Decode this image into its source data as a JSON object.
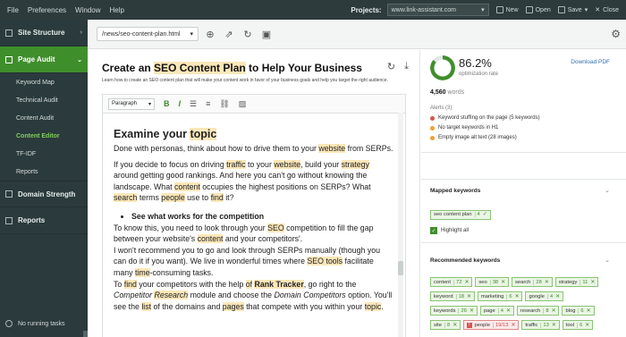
{
  "menu": [
    "File",
    "Preferences",
    "Window",
    "Help"
  ],
  "projects": {
    "label": "Projects:",
    "value": "www.link-assistant.com"
  },
  "toolbar_buttons": {
    "new": "New",
    "open": "Open",
    "save": "Save",
    "close": "Close"
  },
  "sidebar": {
    "site_structure": "Site Structure",
    "page_audit": "Page Audit",
    "sub_items": [
      "Keyword Map",
      "Technical Audit",
      "Content Audit",
      "Content Editor",
      "TF-IDF",
      "Reports"
    ],
    "active_sub": "Content Editor",
    "domain_strength": "Domain Strength",
    "reports": "Reports",
    "footer": "No running tasks"
  },
  "address": {
    "url": "/news/seo-content-plan.html"
  },
  "doc": {
    "title_pre": "Create an ",
    "title_hl": "SEO Content Plan",
    "title_post": " to Help Your Business",
    "desc": "Learn how to create an SEO content plan that will make your content work in favor of your business goals and help you target the right audience.",
    "paragraph_select": "Paragraph"
  },
  "content": {
    "heading_pre": "Examine your ",
    "heading_hl": "topic",
    "p1": [
      {
        "t": "Done with personas, think about how to drive them to your "
      },
      {
        "t": "website",
        "h": true
      },
      {
        "t": " from SERPs."
      }
    ],
    "p2": [
      {
        "t": "If you decide to focus on driving "
      },
      {
        "t": "traffic",
        "h": true
      },
      {
        "t": " to your "
      },
      {
        "t": "website",
        "h": true
      },
      {
        "t": ", build your "
      },
      {
        "t": "strategy",
        "h": true
      },
      {
        "t": " around getting good rankings. And here you can't go without knowing the landscape. What "
      },
      {
        "t": "content",
        "h": true
      },
      {
        "t": " occupies the highest positions on SERPs? What "
      },
      {
        "t": "search",
        "h": true
      },
      {
        "t": " terms "
      },
      {
        "t": "people",
        "h": true
      },
      {
        "t": " use to "
      },
      {
        "t": "find",
        "h": true
      },
      {
        "t": " it?"
      }
    ],
    "bullet": "See what works for the competition",
    "p3": [
      {
        "t": "To know this, you need to look through your "
      },
      {
        "t": "SEO",
        "h": true
      },
      {
        "t": " competition to fill the gap between your website's "
      },
      {
        "t": "content",
        "h": true
      },
      {
        "t": " and your competitors'."
      }
    ],
    "p4": [
      {
        "t": "I won't recommend you to go and look through SERPs manually (though you can do it if you want). We live in wonderful times where "
      },
      {
        "t": "SEO tools",
        "h": true
      },
      {
        "t": " facilitate many "
      },
      {
        "t": "time",
        "h": true
      },
      {
        "t": "-consuming tasks."
      }
    ],
    "p5": [
      {
        "t": "To "
      },
      {
        "t": "find",
        "h": true
      },
      {
        "t": " your competitors with the help "
      },
      {
        "t": "of",
        "h": true
      },
      {
        "t": " "
      },
      {
        "t": "Rank Tracker",
        "h": true,
        "b": true
      },
      {
        "t": ", go right to the "
      },
      {
        "t": "Competitor ",
        "i": true
      },
      {
        "t": "Research",
        "h": true,
        "i": true
      },
      {
        "t": " module and choose the "
      },
      {
        "t": "Domain Competitors",
        "i": true
      },
      {
        "t": " option. You'll see the "
      },
      {
        "t": "list",
        "h": true
      },
      {
        "t": " of the domains and "
      },
      {
        "t": "pages",
        "h": true
      },
      {
        "t": " that compete with you within your "
      },
      {
        "t": "topic",
        "h": true
      },
      {
        "t": "."
      }
    ]
  },
  "score": {
    "value": "86.2%",
    "label": "optimization rate",
    "fraction": 0.862,
    "download": "Download PDF",
    "words_count": "4,560",
    "words_label": "words",
    "alerts_title": "Alerts (3)",
    "alerts": [
      {
        "text": "Keyword stuffing on the page (5 keywords)",
        "color": "#d9534f"
      },
      {
        "text": "No target keywords in H1",
        "color": "#f0a030"
      },
      {
        "text": "Empty image alt text (28 images)",
        "color": "#f0a030"
      }
    ]
  },
  "mapped": {
    "title": "Mapped keywords",
    "keywords": [
      {
        "k": "seo content plan",
        "n": "4"
      }
    ],
    "highlight_all": "Highlight all"
  },
  "recommended": {
    "title": "Recommended keywords",
    "keywords": [
      {
        "k": "content",
        "n": "72"
      },
      {
        "k": "seo",
        "n": "38"
      },
      {
        "k": "search",
        "n": "28"
      },
      {
        "k": "strategy",
        "n": "11"
      },
      {
        "k": "keyword",
        "n": "18"
      },
      {
        "k": "marketing",
        "n": "6"
      },
      {
        "k": "google",
        "n": "4"
      },
      {
        "k": "keywords",
        "n": "26"
      },
      {
        "k": "page",
        "n": "4"
      },
      {
        "k": "research",
        "n": "8"
      },
      {
        "k": "blog",
        "n": "6"
      },
      {
        "k": "site",
        "n": "8"
      },
      {
        "k": "people",
        "n": "19/13",
        "warn": true
      },
      {
        "k": "traffic",
        "n": "13"
      },
      {
        "k": "tool",
        "n": "6"
      }
    ]
  }
}
